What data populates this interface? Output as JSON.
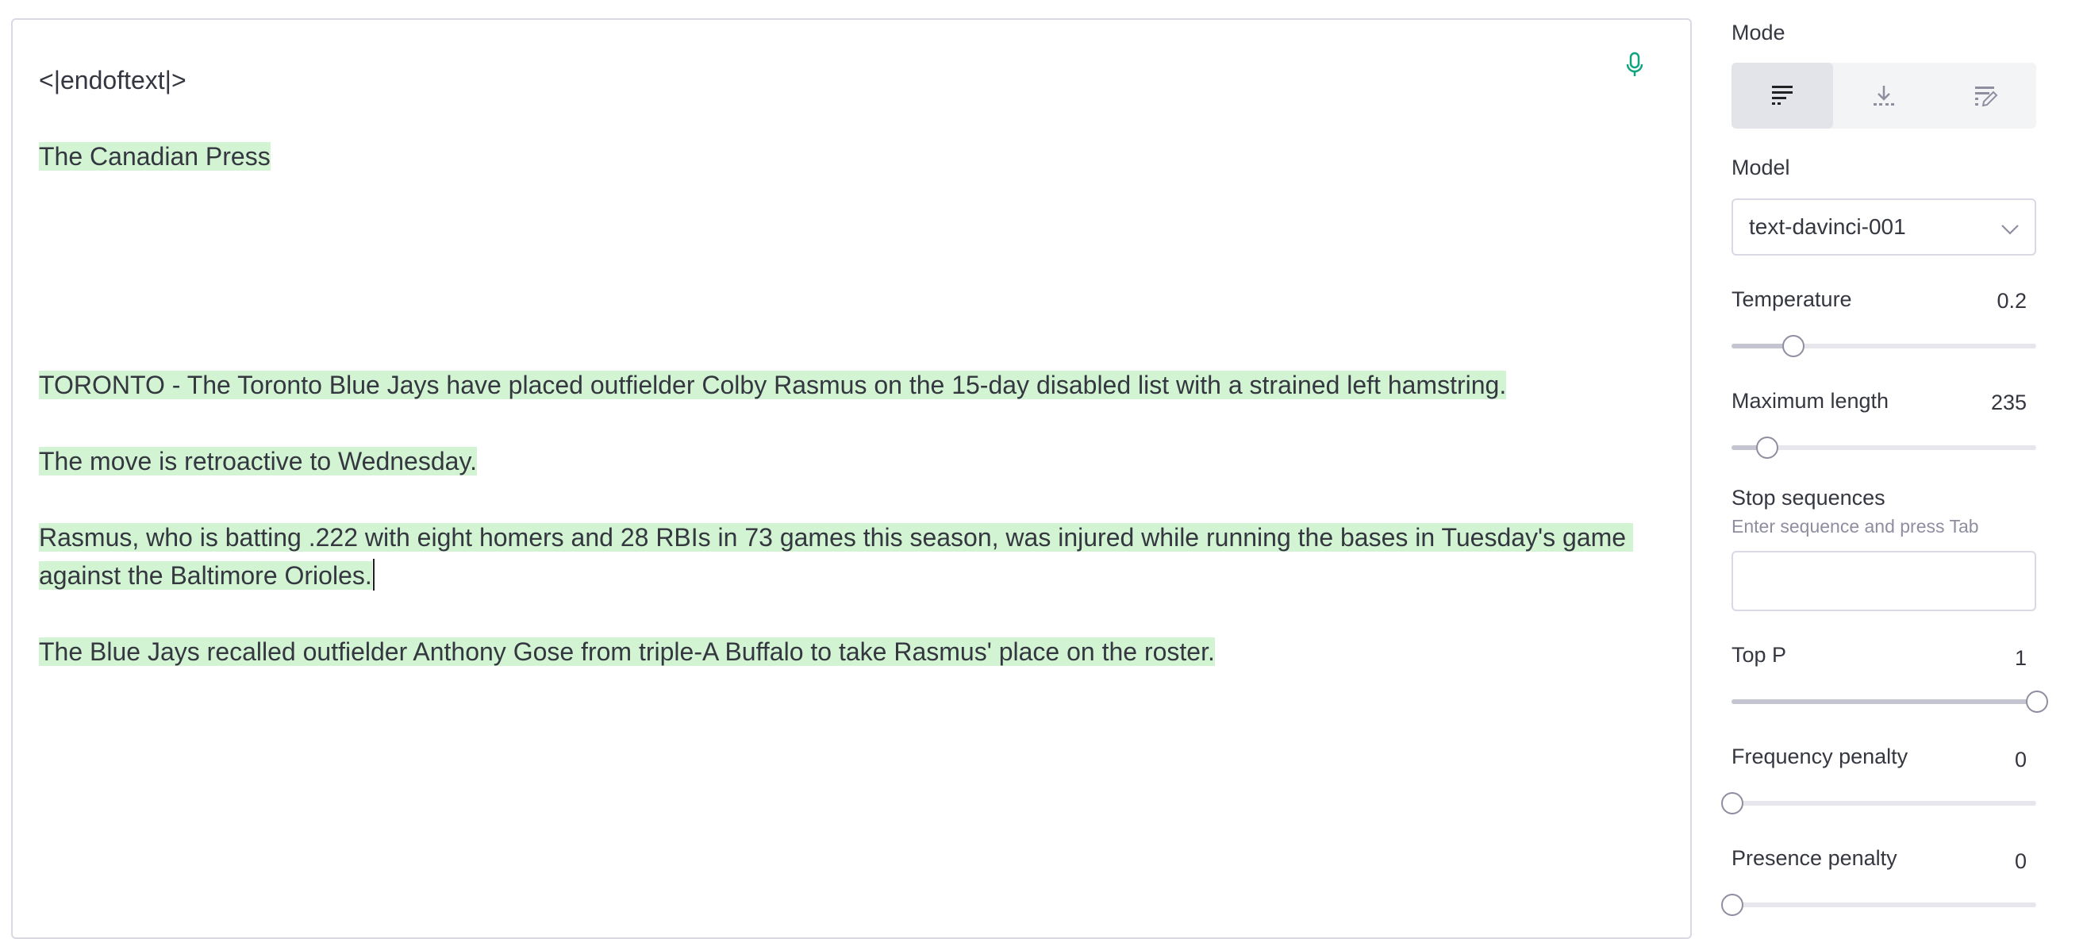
{
  "editor": {
    "paragraphs": [
      {
        "text": "<|endoftext|>",
        "highlighted": false
      },
      {
        "text": "The Canadian Press",
        "highlighted": true
      },
      {
        "text": "",
        "highlighted": false
      },
      {
        "text": "",
        "highlighted": false
      },
      {
        "text": "TORONTO - The Toronto Blue Jays have placed outfielder Colby Rasmus on the 15-day disabled list with a strained left hamstring.",
        "highlighted": true
      },
      {
        "text": "The move is retroactive to Wednesday.",
        "highlighted": true
      },
      {
        "text": "Rasmus, who is batting .222 with eight homers and 28 RBIs in 73 games this season, was injured while running the bases in Tuesday's game against the Baltimore Orioles.",
        "highlighted": true,
        "caret": true
      },
      {
        "text": "The Blue Jays recalled outfielder Anthony Gose from triple-A Buffalo to take Rasmus' place on the roster.",
        "highlighted": true
      }
    ],
    "mic_icon": "microphone-icon"
  },
  "sidebar": {
    "mode": {
      "label": "Mode",
      "options": [
        {
          "name": "complete",
          "icon": "complete-mode-icon",
          "active": true
        },
        {
          "name": "insert",
          "icon": "insert-mode-icon",
          "active": false
        },
        {
          "name": "edit",
          "icon": "edit-mode-icon",
          "active": false
        }
      ]
    },
    "model": {
      "label": "Model",
      "selected": "text-davinci-001",
      "icon": "chevron-down-icon"
    },
    "temperature": {
      "label": "Temperature",
      "value": "0.2",
      "fraction": 0.2
    },
    "max_length": {
      "label": "Maximum length",
      "value": "235",
      "fraction": 0.115
    },
    "stop_sequences": {
      "label": "Stop sequences",
      "hint": "Enter sequence and press Tab",
      "value": ""
    },
    "top_p": {
      "label": "Top P",
      "value": "1",
      "fraction": 1.0
    },
    "frequency_penalty": {
      "label": "Frequency penalty",
      "value": "0",
      "fraction": 0.0
    },
    "presence_penalty": {
      "label": "Presence penalty",
      "value": "0",
      "fraction": 0.0
    }
  },
  "colors": {
    "highlight": "#d2f4d3",
    "accent": "#10a37f"
  }
}
